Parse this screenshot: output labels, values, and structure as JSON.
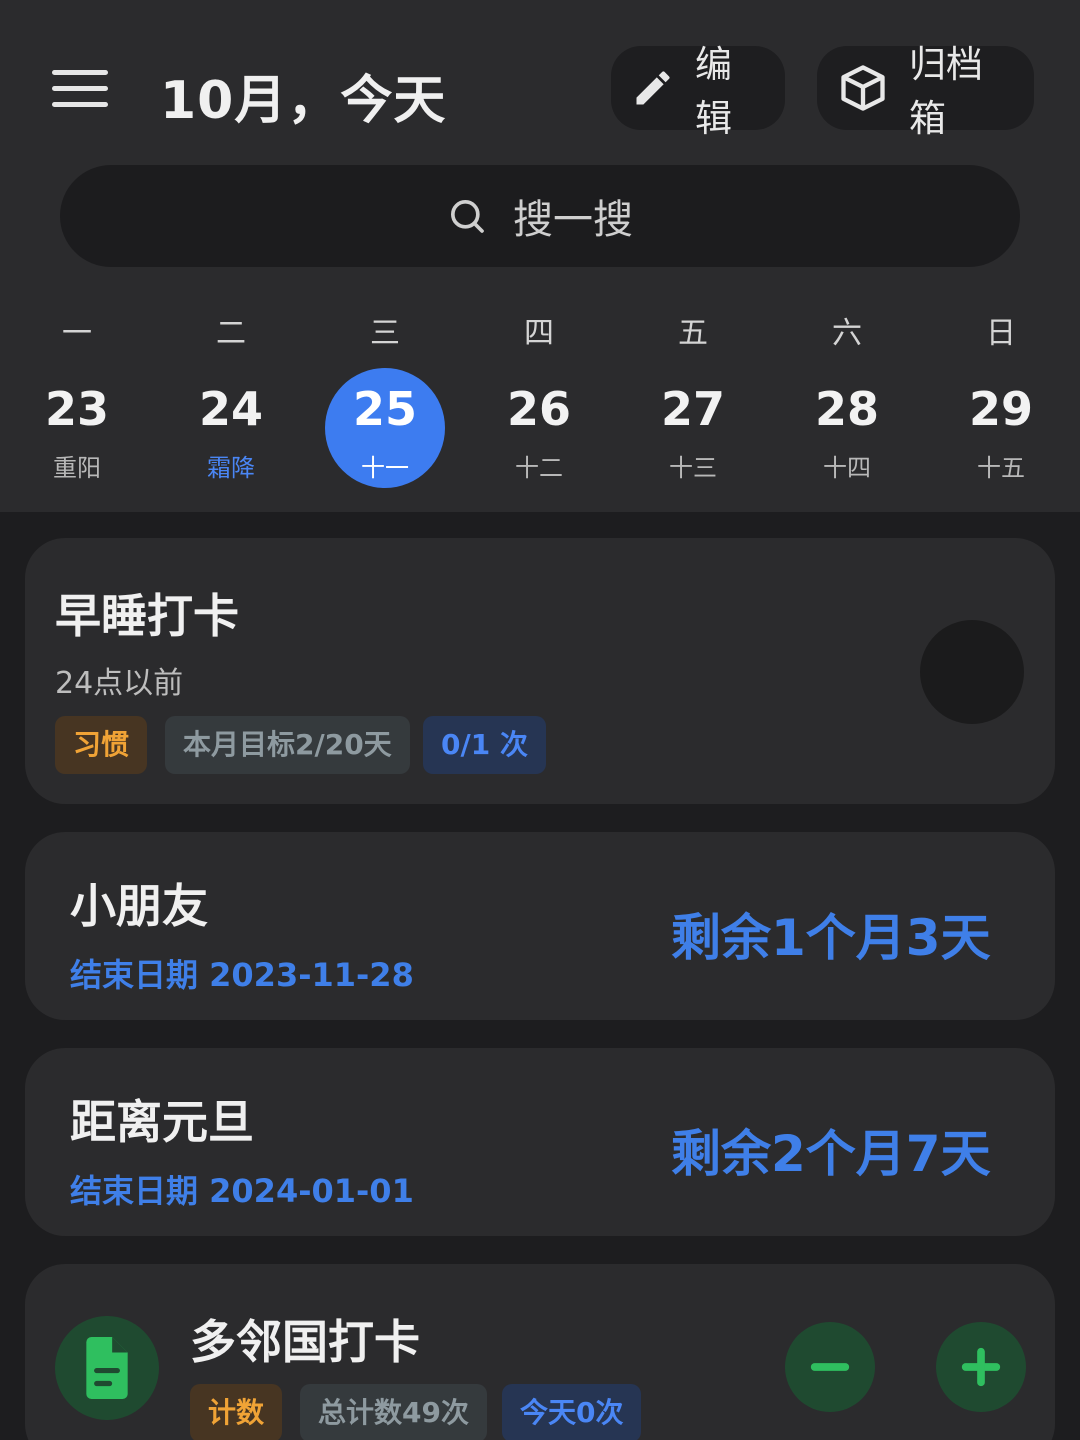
{
  "header": {
    "title": "10月，今天",
    "edit_label": "编辑",
    "archive_label": "归档箱"
  },
  "search": {
    "placeholder": "搜一搜"
  },
  "week": {
    "weekdays": [
      "一",
      "二",
      "三",
      "四",
      "五",
      "六",
      "日"
    ],
    "days": [
      {
        "num": "23",
        "sub": "重阳"
      },
      {
        "num": "24",
        "sub": "霜降"
      },
      {
        "num": "25",
        "sub": "十一"
      },
      {
        "num": "26",
        "sub": "十二"
      },
      {
        "num": "27",
        "sub": "十三"
      },
      {
        "num": "28",
        "sub": "十四"
      },
      {
        "num": "29",
        "sub": "十五"
      }
    ],
    "selected_index": 2
  },
  "cards": {
    "sleep": {
      "title": "早睡打卡",
      "desc": "24点以前",
      "tag_type": "习惯",
      "tag_goal": "本月目标2/20天",
      "tag_count": "0/1 次"
    },
    "kid": {
      "title": "小朋友",
      "end_date": "结束日期 2023-11-28",
      "remaining": "剩余1个月3天"
    },
    "newyear": {
      "title": "距离元旦",
      "end_date": "结束日期 2024-01-01",
      "remaining": "剩余2个月7天"
    },
    "duolingo": {
      "title": "多邻国打卡",
      "tag_type": "计数",
      "tag_total": "总计数49次",
      "tag_today": "今天0次"
    }
  },
  "colors": {
    "accent_blue": "#3d7cf0",
    "green": "#2fbf5f",
    "orange": "#f0a336"
  }
}
